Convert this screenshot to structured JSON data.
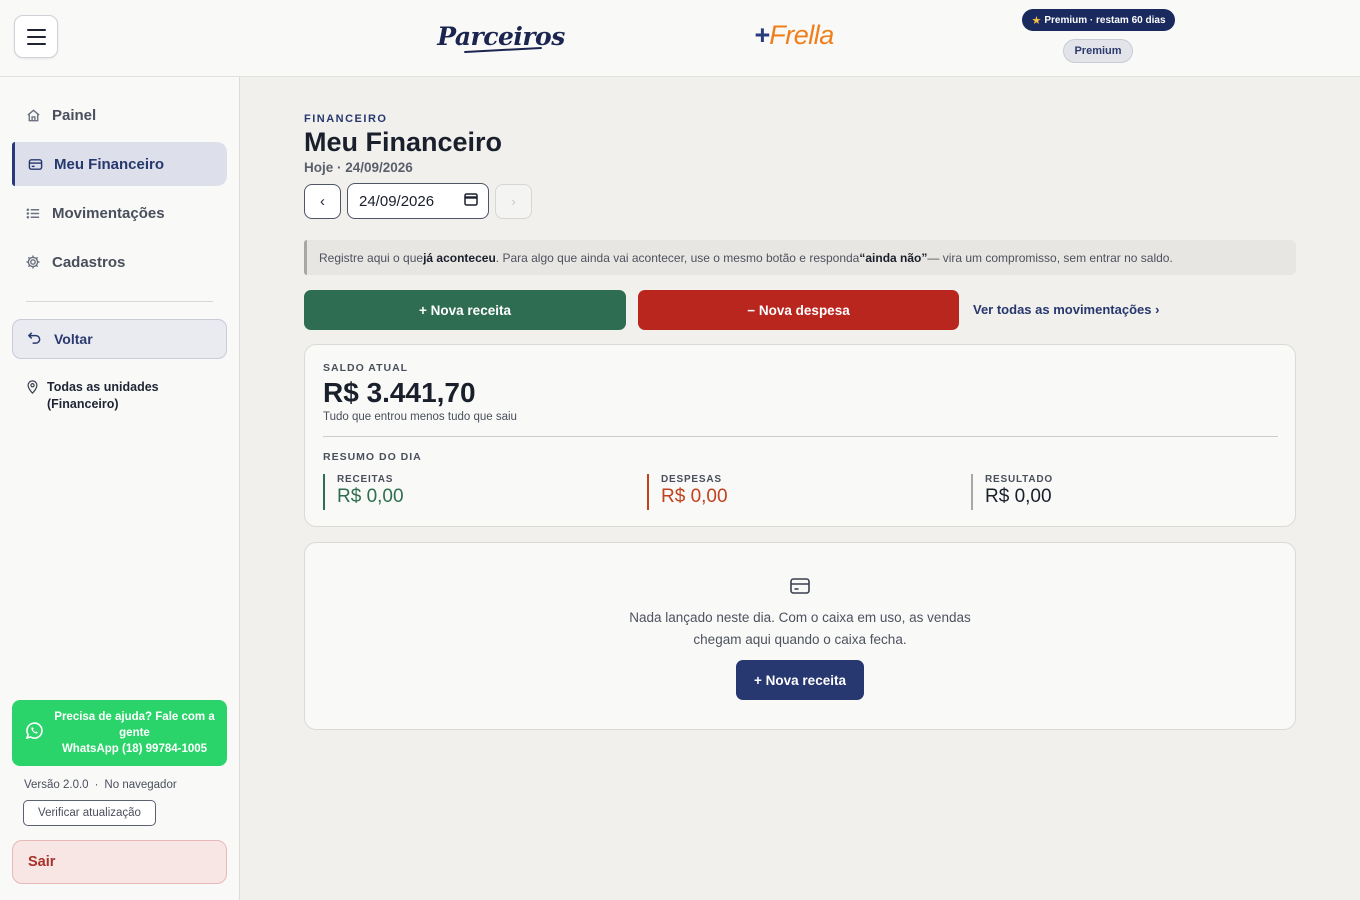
{
  "header": {
    "brand_left": "Parceiros",
    "brand_right_plus": "+",
    "brand_right_name": "Frella",
    "premium_pill": "Premium · restam 60 dias",
    "premium_badge": "Premium"
  },
  "sidebar": {
    "items": [
      {
        "label": "Painel",
        "icon": "home-icon",
        "active": false
      },
      {
        "label": "Meu Financeiro",
        "icon": "wallet-icon",
        "active": true
      },
      {
        "label": "Movimentações",
        "icon": "list-icon",
        "active": false
      },
      {
        "label": "Cadastros",
        "icon": "gear-icon",
        "active": false
      }
    ],
    "back_label": "Voltar",
    "units_label": "Todas as unidades (Financeiro)",
    "help": {
      "line1": "Precisa de ajuda? Fale com a gente",
      "line2": "WhatsApp (18) 99784-1005"
    },
    "version": "Versão 2.0.0",
    "version_sep": "·",
    "runtime": "No navegador",
    "check_update": "Verificar atualização",
    "logout": "Sair"
  },
  "main": {
    "section_label": "FINANCEIRO",
    "title": "Meu Financeiro",
    "today": "Hoje · 24/09/2026",
    "date_prev": "‹",
    "date_value": "24/09/2026",
    "date_next": "›",
    "banner": {
      "part1": "Registre aqui o que ",
      "bold1": "já aconteceu",
      "part2": ". Para algo que ainda vai acontecer, use o mesmo botão e responda ",
      "bold2": "“ainda não”",
      "part3": " — vira um compromisso, sem entrar no saldo."
    },
    "btn_income": "+ Nova receita",
    "btn_expense": "− Nova despesa",
    "link_all": "Ver todas as movimentações ›",
    "balance": {
      "label": "SALDO ATUAL",
      "value": "R$ 3.441,70",
      "subtitle": "Tudo que entrou menos tudo que saiu",
      "summary_label": "RESUMO DO DIA",
      "income_label": "RECEITAS",
      "income_value": "R$ 0,00",
      "expense_label": "DESPESAS",
      "expense_value": "R$ 0,00",
      "result_label": "RESULTADO",
      "result_value": "R$ 0,00"
    },
    "empty": {
      "line1": "Nada lançado neste dia. Com o caixa em uso, as vendas",
      "line2": "chegam aqui quando o caixa fecha.",
      "button": "+ Nova receita"
    }
  },
  "colors": {
    "income": "#2f6d52",
    "expense": "#b9261e",
    "primary": "#27376f",
    "whatsapp": "#2bd46a"
  }
}
